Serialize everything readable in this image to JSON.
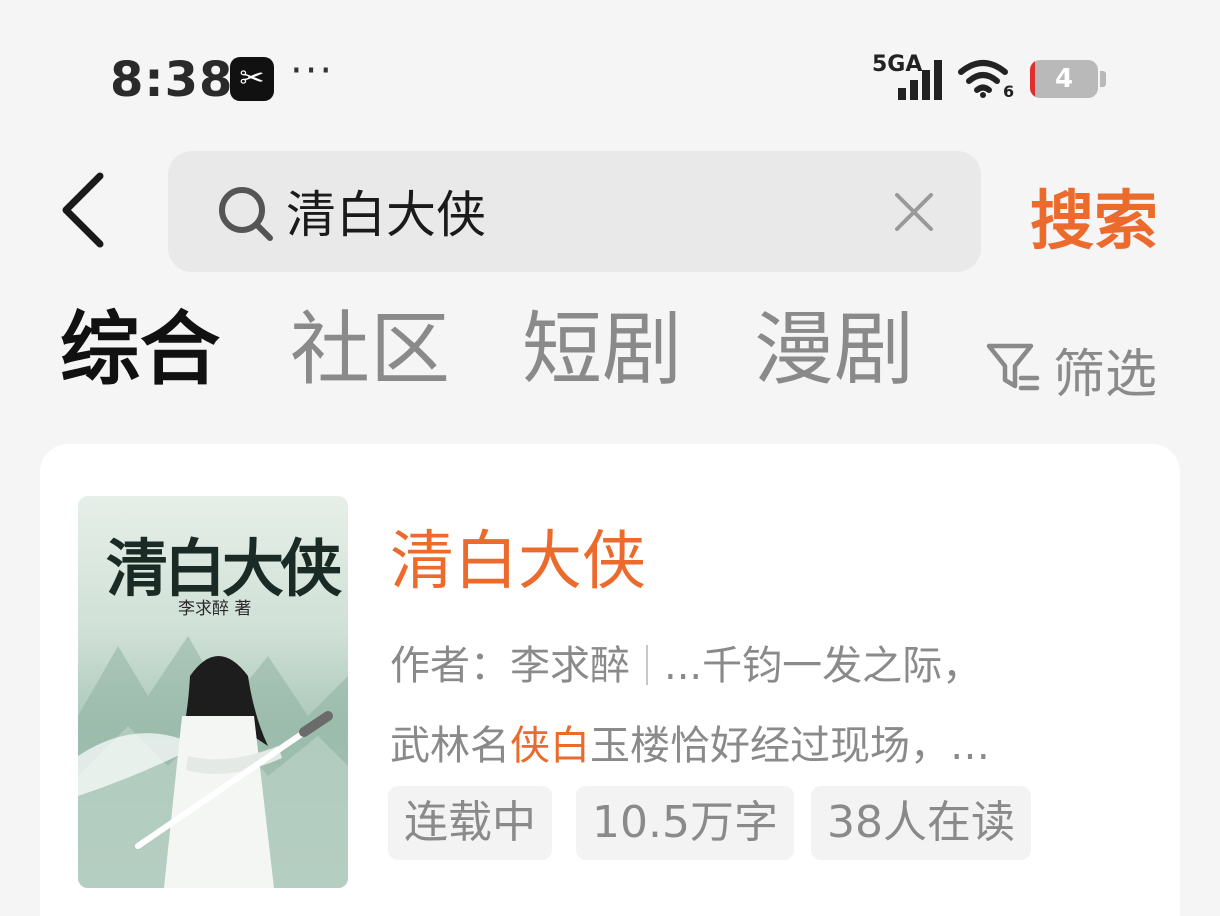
{
  "status_bar": {
    "time": "8:38",
    "app_badge": "✂",
    "more": "···",
    "network": "5GA",
    "wifi_sub": "6",
    "battery": "4",
    "battery_level": 0.04
  },
  "search": {
    "query": "清白大侠",
    "submit_label": "搜索"
  },
  "tabs": [
    {
      "label": "综合",
      "active": true
    },
    {
      "label": "社区",
      "active": false
    },
    {
      "label": "短剧",
      "active": false
    },
    {
      "label": "漫剧",
      "active": false
    }
  ],
  "filter": {
    "label": "筛选"
  },
  "result": {
    "cover_title": "清白大侠",
    "cover_author": "李求醉 著",
    "title": "清白大侠",
    "author_line": "作者：李求醉",
    "snippet_1": "...千钧一发之际，",
    "snippet_2a": "武林名",
    "snippet_2_highlight": "侠白",
    "snippet_2b": "玉楼恰好经过现场，…",
    "tags": [
      "连载中",
      "10.5万字",
      "38人在读"
    ]
  },
  "colors": {
    "accent": "#ec6a2c",
    "muted": "#8a8a8a"
  }
}
